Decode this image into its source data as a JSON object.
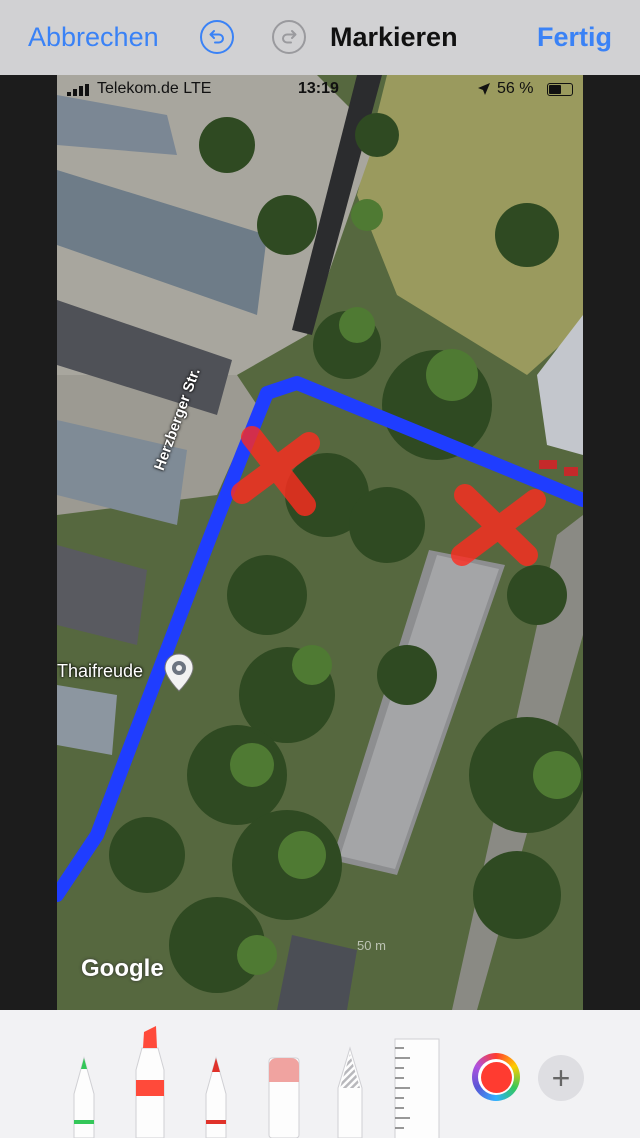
{
  "toolbar": {
    "cancel_label": "Abbrechen",
    "title": "Markieren",
    "done_label": "Fertig",
    "undo_icon": "undo-icon",
    "redo_icon": "redo-icon",
    "accent_color": "#3a82f6"
  },
  "screenshot": {
    "status_bar": {
      "carrier": "Telekom.de  LTE",
      "time": "13:19",
      "battery_percent": "56 %",
      "battery_level": 0.56
    },
    "map": {
      "street_label": "Herzberger Str.",
      "place_label": "Thaifreude",
      "logo_text": "Google",
      "scale_text": "50 m",
      "route_color": "#1f3dff"
    },
    "markup_marks": [
      "x-mark",
      "x-mark"
    ],
    "markup_color": "#ff2a1f"
  },
  "tools": {
    "items": [
      "pen",
      "marker",
      "pencil",
      "eraser",
      "lasso",
      "ruler"
    ],
    "selected_color": "#ff3b30"
  }
}
